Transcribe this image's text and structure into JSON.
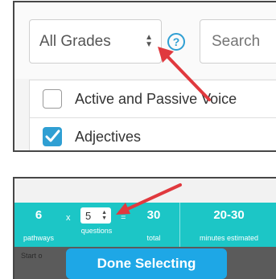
{
  "filters": {
    "grade_select": "All Grades",
    "help_glyph": "?",
    "search_placeholder": "Search"
  },
  "activities": [
    {
      "label": "Active and Passive Voice",
      "checked": false
    },
    {
      "label": "Adjectives",
      "checked": true
    }
  ],
  "summary": {
    "pathways_value": "6",
    "pathways_label": "pathways",
    "times_symbol": "x",
    "questions_value": "5",
    "questions_label": "questions",
    "equals_symbol": "=",
    "total_value": "30",
    "total_label": "total",
    "minutes_value": "20-30",
    "minutes_label": "minutes estimated"
  },
  "footer": {
    "start_text": "Start o",
    "done_button": "Done Selecting"
  },
  "colors": {
    "teal": "#1cc6c6",
    "button_blue": "#1ea7e6",
    "arrow_red": "#e0393e",
    "checkbox_blue": "#2f9fd3"
  },
  "icons": [
    "help-icon",
    "select-caret-icon",
    "checkbox-icon",
    "checkmark-icon",
    "annotation-arrow"
  ]
}
